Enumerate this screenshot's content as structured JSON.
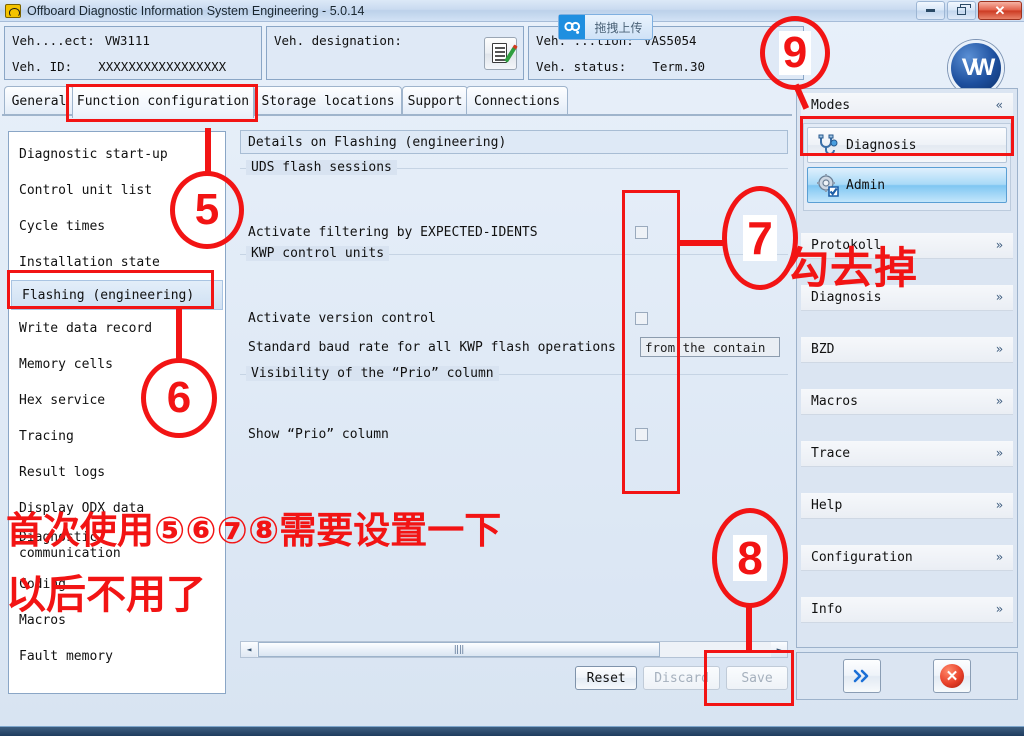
{
  "window": {
    "title": "Offboard Diagnostic Information System Engineering - 5.0.14",
    "app_icon": "engine-warning-icon",
    "minimize_label": "–",
    "restore_label": "❐",
    "close_label": "✕"
  },
  "upload_overlay": {
    "label": "拖拽上传",
    "icon": "drag-upload-icon"
  },
  "header": {
    "project_label": "Veh....ect:",
    "project_value": "VW3111",
    "vehid_label": "Veh. ID:",
    "vehid_value": "XXXXXXXXXXXXXXXXX",
    "designation_label": "Veh. designation:",
    "designation_value": "",
    "connection_label": "Veh. ...tion:",
    "connection_value": "VAS5054",
    "status_label": "Veh. status:",
    "status_value": "Term.30",
    "edit_button_icon": "notepad-edit-icon",
    "brand_logo": "vw-logo"
  },
  "tabs": [
    {
      "label": "General",
      "active": false
    },
    {
      "label": "Function configuration",
      "active": true
    },
    {
      "label": "Storage locations",
      "active": false
    },
    {
      "label": "Support",
      "active": false
    },
    {
      "label": "Connections",
      "active": false
    }
  ],
  "left_list": {
    "items": [
      {
        "label": "Diagnostic start-up",
        "selected": false
      },
      {
        "label": "Control unit list",
        "selected": false
      },
      {
        "label": "Cycle times",
        "selected": false
      },
      {
        "label": "Installation state",
        "selected": false
      },
      {
        "label": "Flashing (engineering)",
        "selected": true
      },
      {
        "label": "Write data record",
        "selected": false
      },
      {
        "label": "Memory cells",
        "selected": false
      },
      {
        "label": "Hex service",
        "selected": false
      },
      {
        "label": "Tracing",
        "selected": false
      },
      {
        "label": "Result logs",
        "selected": false
      },
      {
        "label": "Display ODX data",
        "selected": false
      },
      {
        "label": "Diagnostic",
        "label2": "communication",
        "selected": false
      },
      {
        "label": "Coding",
        "selected": false
      },
      {
        "label": "Macros",
        "selected": false
      },
      {
        "label": "Fault memory",
        "selected": false
      }
    ]
  },
  "details": {
    "title": "Details on Flashing (engineering)",
    "groups": [
      {
        "title": "UDS flash sessions",
        "rows": [
          {
            "label": "Activate filtering by EXPECTED-IDENTS",
            "control": "checkbox",
            "checked": false
          }
        ]
      },
      {
        "title": "KWP control units",
        "rows": [
          {
            "label": "Activate version control",
            "control": "checkbox",
            "checked": false
          },
          {
            "label": "Standard baud rate for all KWP flash operations",
            "control": "combo",
            "value": "from the contain"
          }
        ]
      },
      {
        "title": "Visibility of the “Prio” column",
        "rows": [
          {
            "label": "Show “Prio” column",
            "control": "checkbox",
            "checked": false
          }
        ]
      }
    ]
  },
  "scrollbar": {
    "left_arrow": "◄",
    "right_arrow": "►",
    "grip": "‖‖"
  },
  "action_buttons": [
    {
      "label": "Reset",
      "disabled": false
    },
    {
      "label": "Discard",
      "disabled": true
    },
    {
      "label": "Save",
      "disabled": true
    }
  ],
  "sidebar": {
    "modes_header": "Modes",
    "modes_chevron": "«",
    "modes": [
      {
        "label": "Diagnosis",
        "icon": "stethoscope-icon",
        "active": false
      },
      {
        "label": "Admin",
        "icon": "gear-check-icon",
        "active": true
      }
    ],
    "sections": [
      {
        "label": "Protokoll",
        "chevron": "»"
      },
      {
        "label": "Diagnosis",
        "chevron": "»"
      },
      {
        "label": "BZD",
        "chevron": "»"
      },
      {
        "label": "Macros",
        "chevron": "»"
      },
      {
        "label": "Trace",
        "chevron": "»"
      },
      {
        "label": "Help",
        "chevron": "»"
      },
      {
        "label": "Configuration",
        "chevron": "»"
      },
      {
        "label": "Info",
        "chevron": "»"
      }
    ],
    "next_button_icon": "double-chevron-right-icon",
    "cancel_button_icon": "cancel-circle-icon",
    "cancel_glyph": "✕"
  },
  "annotations": {
    "accent_color": "#f21414",
    "markers": [
      {
        "id": "5",
        "text": "5"
      },
      {
        "id": "6",
        "text": "6"
      },
      {
        "id": "7",
        "text": "7"
      },
      {
        "id": "8",
        "text": "8"
      },
      {
        "id": "9",
        "text": "9"
      }
    ],
    "note_uncheck": "勾去掉",
    "note_first_use": "首次使用⑤⑥⑦⑧需要设置一下",
    "note_later": "以后不用了"
  }
}
